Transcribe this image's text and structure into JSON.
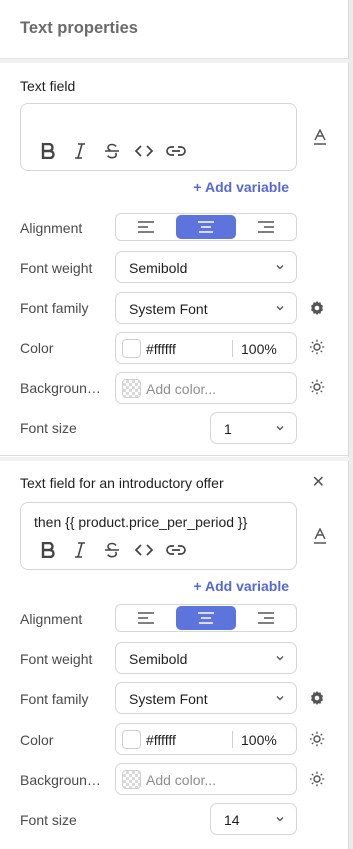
{
  "panel": {
    "title": "Text properties"
  },
  "sections": [
    {
      "title": "Text field",
      "editor_text": "",
      "add_variable": "+ Add variable",
      "labels": {
        "alignment": "Alignment",
        "font_weight": "Font weight",
        "font_family": "Font family",
        "color": "Color",
        "background": "Backgroun…",
        "font_size": "Font size"
      },
      "alignment_selected": "center",
      "font_weight": "Semibold",
      "font_family": "System Font",
      "color": {
        "hex": "#ffffff",
        "opacity": "100%"
      },
      "background_placeholder": "Add color...",
      "font_size": "1"
    },
    {
      "title": "Text field for an introductory offer",
      "editor_text": "then {{ product.price_per_period }}",
      "add_variable": "+ Add variable",
      "labels": {
        "alignment": "Alignment",
        "font_weight": "Font weight",
        "font_family": "Font family",
        "color": "Color",
        "background": "Backgroun…",
        "font_size": "Font size"
      },
      "alignment_selected": "center",
      "font_weight": "Semibold",
      "font_family": "System Font",
      "color": {
        "hex": "#ffffff",
        "opacity": "100%"
      },
      "background_placeholder": "Add color...",
      "font_size": "14"
    }
  ],
  "colors": {
    "accent": "#5d74dc",
    "link": "#5468d8"
  }
}
